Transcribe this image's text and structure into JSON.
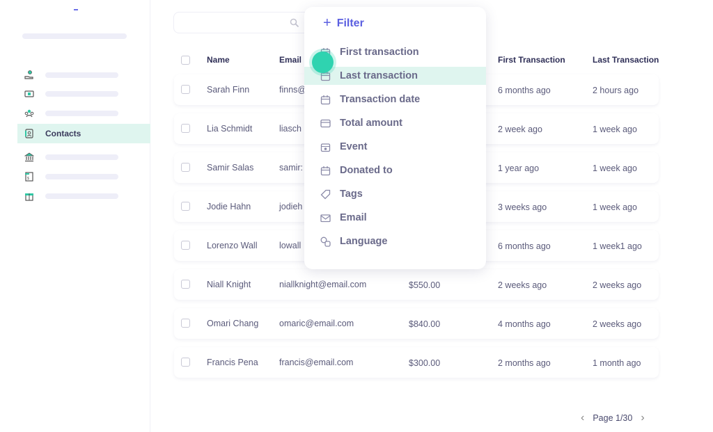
{
  "sidebar": {
    "items": [
      {
        "icon": "hand-money-icon",
        "label": ""
      },
      {
        "icon": "ticket-icon",
        "label": ""
      },
      {
        "icon": "group-icon",
        "label": ""
      },
      {
        "icon": "contacts-icon",
        "label": "Contacts",
        "active": true
      },
      {
        "icon": "bank-icon",
        "label": ""
      },
      {
        "icon": "invoice-icon",
        "label": ""
      },
      {
        "icon": "gift-icon",
        "label": ""
      }
    ]
  },
  "search": {
    "value": "",
    "placeholder": "",
    "icon": "search-icon"
  },
  "table": {
    "columns": [
      "Name",
      "Email",
      "",
      "First Transaction",
      "Last Transaction"
    ],
    "rows": [
      {
        "name": "Sarah Finn",
        "email": "finns@",
        "amount": "",
        "first": "6 months ago",
        "last": "2 hours ago"
      },
      {
        "name": "Lia Schmidt",
        "email": "liasch",
        "amount": "",
        "first": "2 week ago",
        "last": "1 week ago"
      },
      {
        "name": "Samir Salas",
        "email": "samir:",
        "amount": "",
        "first": "1 year ago",
        "last": "1  week ago"
      },
      {
        "name": "Jodie Hahn",
        "email": "jodieh",
        "amount": "",
        "first": "3 weeks ago",
        "last": "1 week ago"
      },
      {
        "name": "Lorenzo Wall",
        "email": "lowall",
        "amount": "",
        "first": "6 months ago",
        "last": "1 week1 ago"
      },
      {
        "name": "Niall Knight",
        "email": "niallknight@email.com",
        "amount": "$550.00",
        "first": "2 weeks ago",
        "last": "2 weeks ago"
      },
      {
        "name": "Omari Chang",
        "email": "omaric@email.com",
        "amount": "$840.00",
        "first": "4 months ago",
        "last": "2 weeks ago"
      },
      {
        "name": "Francis Pena",
        "email": "francis@email.com",
        "amount": "$300.00",
        "first": "2 months ago",
        "last": "1 month ago"
      }
    ]
  },
  "filter_menu": {
    "title": "Filter",
    "items": [
      {
        "label": "First transaction",
        "icon": "calendar-icon"
      },
      {
        "label": "Last transaction",
        "icon": "calendar-icon",
        "highlighted": true
      },
      {
        "label": "Transaction date",
        "icon": "calendar-icon"
      },
      {
        "label": "Total amount",
        "icon": "card-icon"
      },
      {
        "label": "Event",
        "icon": "calendar-star-icon"
      },
      {
        "label": "Donated to",
        "icon": "calendar-icon"
      },
      {
        "label": "Tags",
        "icon": "tag-icon"
      },
      {
        "label": "Email",
        "icon": "envelope-icon"
      },
      {
        "label": "Language",
        "icon": "language-icon"
      }
    ]
  },
  "pagination": {
    "label": "Page 1/30"
  },
  "colors": {
    "accent": "#5b5fe0",
    "highlight": "#dff5ef",
    "cursor": "#2fd3b0",
    "text": "#2f2f57"
  }
}
